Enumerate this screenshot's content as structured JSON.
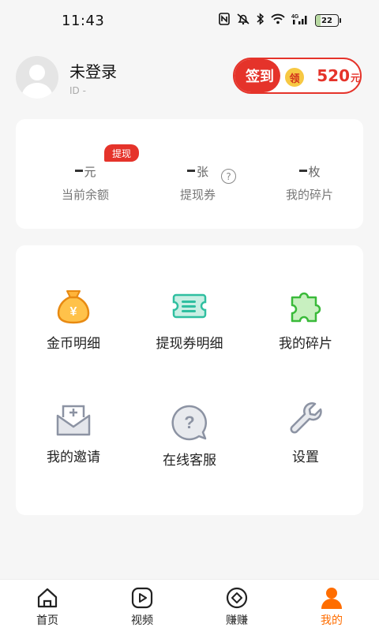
{
  "status_bar": {
    "time": "11:43",
    "battery": "22",
    "network": "4G"
  },
  "profile": {
    "name": "未登录",
    "id_text": "ID  -"
  },
  "signin": {
    "label": "签到",
    "badge": "领",
    "amount": "520",
    "unit": "元"
  },
  "stats": {
    "tag": "提现",
    "items": [
      {
        "unit": "元",
        "label": "当前余额"
      },
      {
        "unit": "张",
        "label": "提现券"
      },
      {
        "unit": "枚",
        "label": "我的碎片"
      }
    ]
  },
  "menu": {
    "items": [
      {
        "label": "金币明细",
        "icon": "money-bag-icon"
      },
      {
        "label": "提现券明细",
        "icon": "coupon-icon"
      },
      {
        "label": "我的碎片",
        "icon": "puzzle-icon"
      },
      {
        "label": "我的邀请",
        "icon": "invite-mail-icon"
      },
      {
        "label": "在线客服",
        "icon": "help-chat-icon"
      },
      {
        "label": "设置",
        "icon": "wrench-icon"
      }
    ]
  },
  "nav": {
    "items": [
      {
        "label": "首页",
        "icon": "home-icon"
      },
      {
        "label": "视频",
        "icon": "play-icon"
      },
      {
        "label": "赚赚",
        "icon": "diamond-icon"
      },
      {
        "label": "我的",
        "icon": "user-icon"
      }
    ],
    "active_index": 3
  },
  "colors": {
    "accent_red": "#e5332a",
    "nav_active": "#ff6d00",
    "background": "#f6f6f6"
  }
}
